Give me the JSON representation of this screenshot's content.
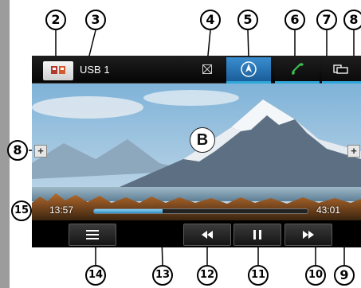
{
  "screen": {
    "source": "USB 1",
    "center_marker": "B",
    "elapsed_time": "13:57",
    "total_time": "43:01",
    "progress": 0.32
  },
  "callouts": [
    "2",
    "3",
    "4",
    "5",
    "6",
    "7",
    "8",
    "8",
    "9",
    "10",
    "11",
    "12",
    "13",
    "14",
    "15"
  ],
  "icons": {
    "source": "usb-source-icon",
    "no_signal": "crossed-box-icon",
    "navigation": "navigation-compass-icon",
    "phone": "phone-handset-icon",
    "apps": "apps-icon",
    "menu": "menu-list-icon",
    "rewind": "rewind-icon",
    "pause": "pause-icon",
    "forward": "fast-forward-icon"
  },
  "colors": {
    "accent": "#2fa6d9",
    "nav_button": "#2a75b8",
    "phone_icon": "#3fbf4f",
    "progress_fill": "#4aa9dd"
  }
}
